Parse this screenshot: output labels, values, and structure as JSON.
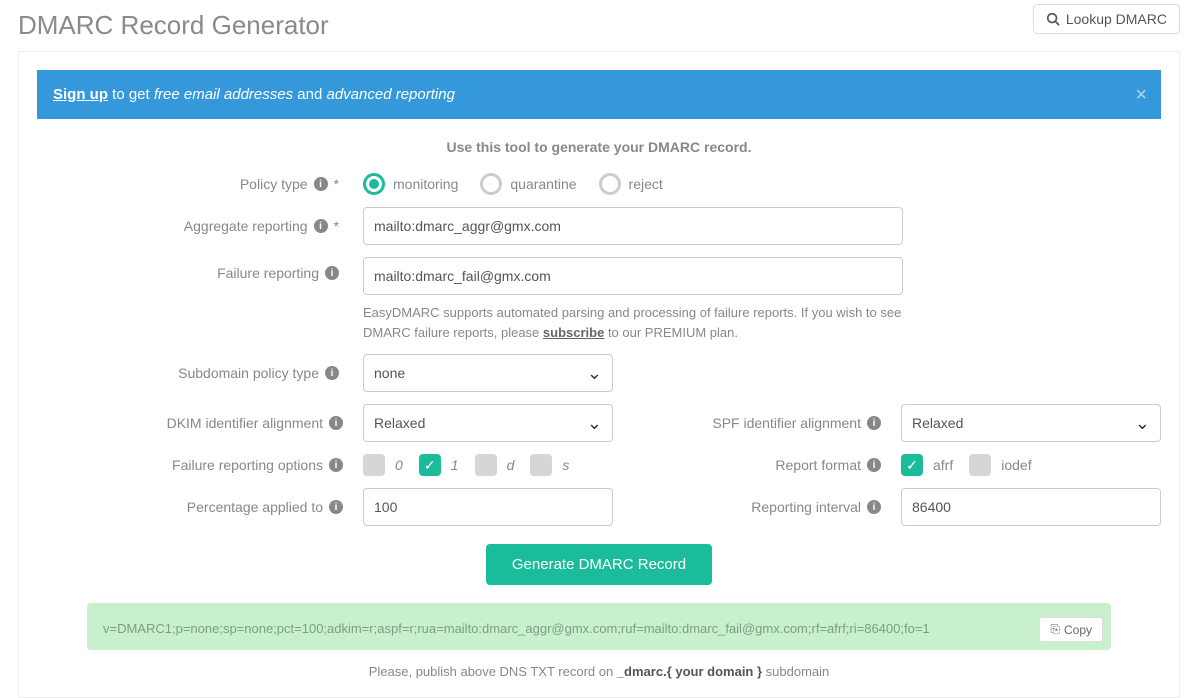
{
  "header": {
    "title": "DMARC Record Generator",
    "lookup_button": "Lookup DMARC"
  },
  "alert": {
    "signup": "Sign up",
    "mid1": " to get ",
    "italic1": "free email addresses",
    "mid2": " and ",
    "italic2": "advanced reporting"
  },
  "intro": "Use this tool to generate your DMARC record.",
  "labels": {
    "policy_type": "Policy type",
    "aggregate_reporting": "Aggregate reporting",
    "failure_reporting": "Failure reporting",
    "subdomain_policy": "Subdomain policy type",
    "dkim_alignment": "DKIM identifier alignment",
    "spf_alignment": "SPF identifier alignment",
    "failure_options": "Failure reporting options",
    "report_format": "Report format",
    "percentage": "Percentage applied to",
    "reporting_interval": "Reporting interval"
  },
  "policy": {
    "monitoring": "monitoring",
    "quarantine": "quarantine",
    "reject": "reject"
  },
  "values": {
    "aggregate_reporting": "mailto:dmarc_aggr@gmx.com",
    "failure_reporting": "mailto:dmarc_fail@gmx.com",
    "subdomain_policy": "none",
    "dkim_alignment": "Relaxed",
    "spf_alignment": "Relaxed",
    "percentage": "100",
    "reporting_interval": "86400"
  },
  "failure_opts": {
    "o0": "0",
    "o1": "1",
    "od": "d",
    "os": "s"
  },
  "report_format": {
    "afrf": "afrf",
    "iodef": "iodef"
  },
  "help": {
    "failure_pre": "EasyDMARC supports automated parsing and processing of failure reports. If you wish to see DMARC failure reports, please ",
    "failure_link": "subscribe",
    "failure_post": " to our PREMIUM plan."
  },
  "buttons": {
    "generate": "Generate DMARC Record",
    "copy": "Copy"
  },
  "result": "v=DMARC1;p=none;sp=none;pct=100;adkim=r;aspf=r;rua=mailto:dmarc_aggr@gmx.com;ruf=mailto:dmarc_fail@gmx.com;rf=afrf;ri=86400;fo=1",
  "publish": {
    "pre": "Please, publish above DNS TXT record on ",
    "host": "_dmarc.{ your domain }",
    "post": " subdomain"
  }
}
